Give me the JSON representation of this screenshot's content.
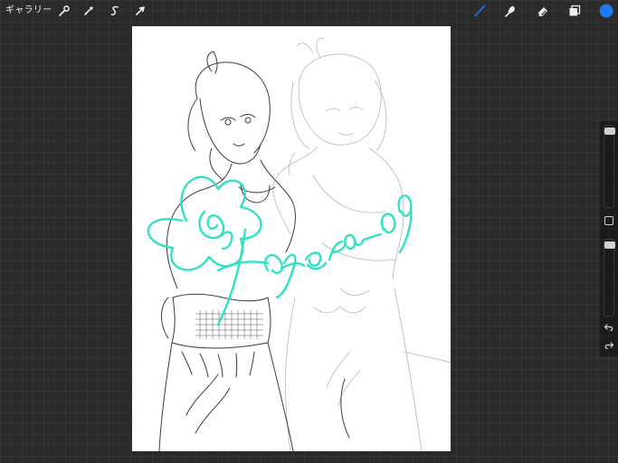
{
  "toolbar": {
    "gallery_label": "ギャラリー",
    "left_icons": [
      "wrench-icon",
      "magic-wand-icon",
      "selection-s-icon",
      "arrow-cursor-icon"
    ],
    "right_icons": [
      "brush-icon",
      "smudge-icon",
      "eraser-icon",
      "layers-icon"
    ],
    "active_tool": "brush-icon",
    "active_tool_color": "#1e6fe8",
    "current_color": "#1a7cff"
  },
  "sidebar": {
    "brush_size": 0.98,
    "opacity": 0.98,
    "undo_icon": "undo-icon",
    "redo_icon": "redo-icon"
  },
  "canvas": {
    "signature_color": "#2ee3c2",
    "background": "#ffffff"
  }
}
